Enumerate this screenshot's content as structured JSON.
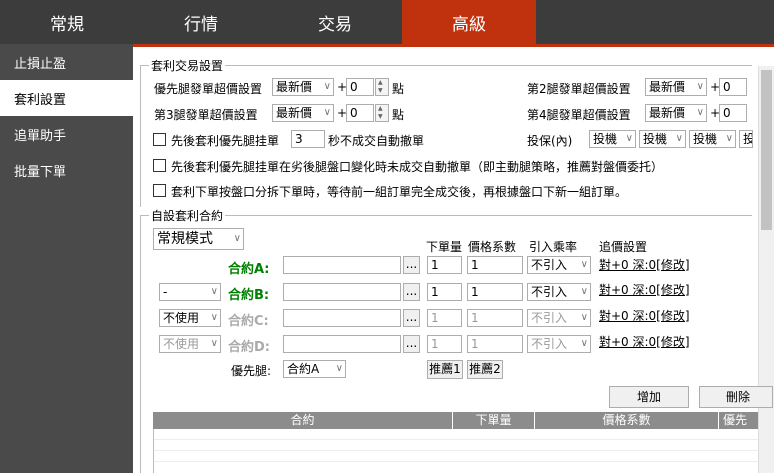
{
  "tabs": [
    {
      "label": "常規"
    },
    {
      "label": "行情"
    },
    {
      "label": "交易"
    },
    {
      "label": "高級"
    }
  ],
  "sidebar": {
    "items": [
      {
        "label": "止損止盈"
      },
      {
        "label": "套利設置"
      },
      {
        "label": "追單助手"
      },
      {
        "label": "批量下單"
      }
    ]
  },
  "arb": {
    "title": "套利交易設置",
    "leg_first_label": "優先腿發單超價設置",
    "leg2_label": "第2腿發單超價設置",
    "leg3_label": "第3腿發單超價設置",
    "leg4_label": "第4腿發單超價設置",
    "price_type": "最新價",
    "plus": "+",
    "value": "0",
    "tick_unit": "點",
    "cb1_pre": "先後套利優先腿挂單",
    "cb1_value": "3",
    "cb1_post": "秒不成交自動撤單",
    "hedge_label": "投保(內)",
    "hedge_value": "投機",
    "hedge_value_cut": "投",
    "cb2": "先後套利優先腿挂單在劣後腿盤口變化時未成交自動撤單（即主動腿策略，推薦對盤價委托）",
    "cb3": "套利下單按盤口分拆下單時，等待前一組訂單完全成交後，再根據盤口下新一組訂單。"
  },
  "custom": {
    "title": "自設套利合約",
    "mode": "常規模式",
    "col_qty": "下單量",
    "col_coef": "價格系數",
    "col_mult": "引入乘率",
    "col_chase": "追價設置",
    "rows": [
      {
        "op": "",
        "label": "合約A:",
        "qty": "1",
        "coef": "1",
        "mult": "不引入",
        "link": "對+0 深:0[修改]"
      },
      {
        "op": "-",
        "label": "合約B:",
        "qty": "1",
        "coef": "1",
        "mult": "不引入",
        "link": "對+0 深:0[修改]"
      },
      {
        "op": "不使用",
        "label": "合約C:",
        "qty": "1",
        "coef": "1",
        "mult": "不引入",
        "link": "對+0 深:0[修改]"
      },
      {
        "op": "不使用",
        "label": "合約D:",
        "qty": "1",
        "coef": "1",
        "mult": "不引入",
        "link": "對+0 深:0[修改]"
      }
    ],
    "browse": "...",
    "priority_label": "優先腿:",
    "priority_value": "合約A",
    "recommend1": "推薦1",
    "recommend2": "推薦2",
    "add_btn": "增加",
    "delete_btn": "刪除",
    "table_headers": [
      "合約",
      "下單量",
      "價格系數",
      "優先"
    ]
  }
}
